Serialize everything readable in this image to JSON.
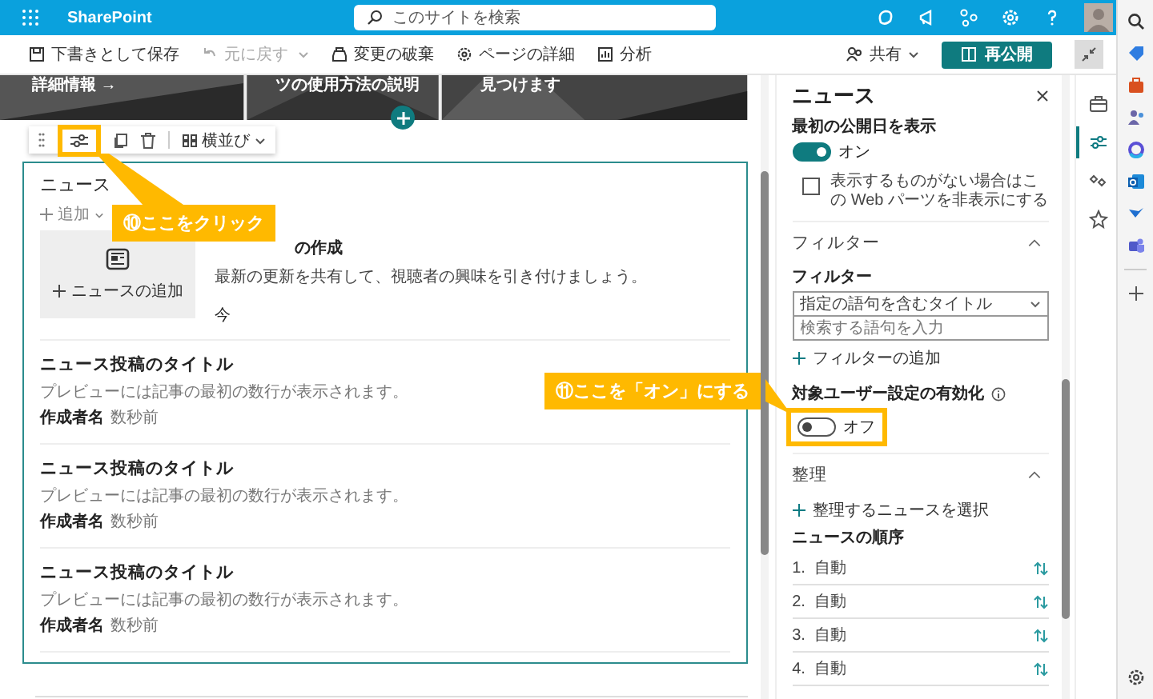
{
  "topbar": {
    "app_name": "SharePoint",
    "search_placeholder": "このサイトを検索"
  },
  "commands": [
    {
      "label": "下書きとして保存",
      "kind": "save",
      "disabled": false
    },
    {
      "label": "元に戻す",
      "kind": "undo",
      "disabled": true
    },
    {
      "label": "変更の破棄",
      "kind": "discard",
      "disabled": false
    },
    {
      "label": "ページの詳細",
      "kind": "details",
      "disabled": false
    },
    {
      "label": "分析",
      "kind": "analytics",
      "disabled": false
    }
  ],
  "share": "共有",
  "republish": "再公開",
  "hero": [
    "詳細情報 →",
    "ツの使用方法の説明",
    "見つけます"
  ],
  "webpart_toolbar": {
    "layout": "横並び"
  },
  "news": {
    "title": "ニュース",
    "add": "追加",
    "add_news": "ニュースの追加",
    "first_post": {
      "title": "の作成",
      "description": "最新の更新を共有して、視聴者の興味を引き付けましょう。",
      "time": "今"
    },
    "posts": [
      {
        "title": "ニュース投稿のタイトル",
        "preview": "プレビューには記事の最初の数行が表示されます。",
        "author": "作成者名",
        "time": "数秒前"
      },
      {
        "title": "ニュース投稿のタイトル",
        "preview": "プレビューには記事の最初の数行が表示されます。",
        "author": "作成者名",
        "time": "数秒前"
      },
      {
        "title": "ニュース投稿のタイトル",
        "preview": "プレビューには記事の最初の数行が表示されます。",
        "author": "作成者名",
        "time": "数秒前"
      }
    ]
  },
  "panel": {
    "title": "ニュース",
    "show_date": {
      "label": "最初の公開日を表示",
      "on": true,
      "state": "オン"
    },
    "hide_empty": {
      "label": "表示するものがない場合はこの Web パーツを非表示にする",
      "checked": false
    },
    "filter_section": {
      "title": "フィルター",
      "expanded": true,
      "label": "フィルター",
      "select_value": "指定の語句を含むタイトル",
      "input_placeholder": "検索する語句を入力",
      "add": "フィルターの追加"
    },
    "audience": {
      "label": "対象ユーザー設定の有効化",
      "on": false,
      "state": "オフ"
    },
    "organize_section": {
      "title": "整理",
      "expanded": true,
      "add": "整理するニュースを選択",
      "order_label": "ニュースの順序",
      "order": [
        {
          "number": "1.",
          "label": "自動"
        },
        {
          "number": "2.",
          "label": "自動"
        },
        {
          "number": "3.",
          "label": "自動"
        },
        {
          "number": "4.",
          "label": "自動"
        }
      ]
    }
  },
  "panel_rail": [
    {
      "selected": false
    },
    {
      "selected": true
    },
    {
      "selected": false
    },
    {
      "selected": false
    }
  ],
  "callouts": [
    "⑩ここをクリック",
    "⑪ここを「オン」にする"
  ]
}
